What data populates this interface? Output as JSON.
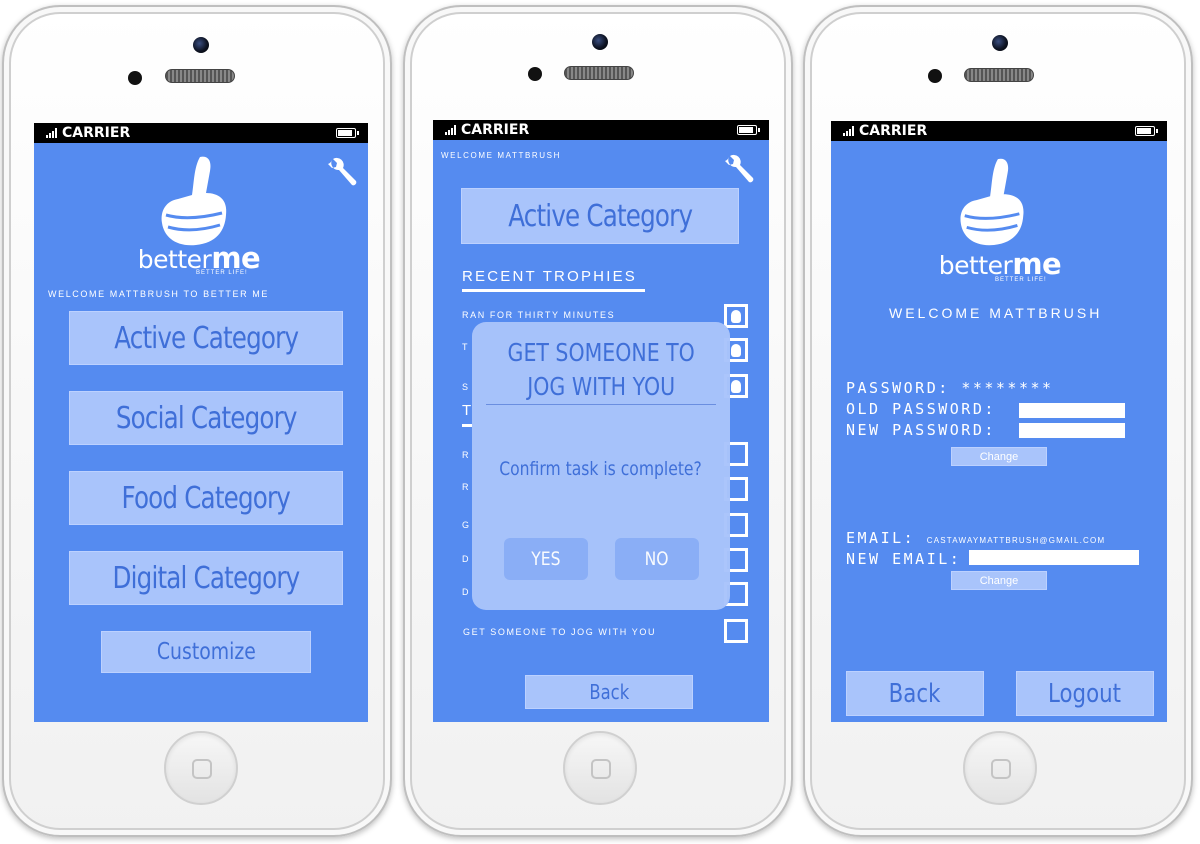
{
  "carrier": "CARRIER",
  "brand": {
    "logo_prefix": "better",
    "logo_suffix": "me",
    "tagline": "BETTER LIFE!"
  },
  "screen1": {
    "welcome": "WELCOME MATTBRUSH TO BETTER ME",
    "categories": [
      "Active Category",
      "Social Category",
      "Food Category",
      "Digital Category"
    ],
    "customize_label": "Customize"
  },
  "screen2": {
    "welcome": "WELCOME MATTBRUSH",
    "category_button": "Active Category",
    "section_heading": "RECENT TROPHIES",
    "trophies": [
      "RAN FOR THIRTY MINUTES",
      "T",
      "S"
    ],
    "tasks_heading_initial": "T",
    "tasks": [
      "R",
      "R",
      "G",
      "D",
      "D",
      "GET SOMEONE TO JOG WITH YOU"
    ],
    "back_label": "Back",
    "modal": {
      "title_line1": "GET SOMEONE TO",
      "title_line2": "JOG WITH YOU",
      "question": "Confirm task is complete?",
      "yes_label": "YES",
      "no_label": "NO"
    }
  },
  "screen3": {
    "welcome": "WELCOME MATTBRUSH",
    "password_label": "PASSWORD:",
    "password_value": "********",
    "old_password_label": "OLD PASSWORD:",
    "new_password_label": "NEW PASSWORD:",
    "change_label": "Change",
    "email_label": "EMAIL:",
    "email_value": "CASTAWAYMATTBRUSH@GMAIL.COM",
    "new_email_label": "NEW EMAIL:",
    "change_label_2": "Change",
    "back_label": "Back",
    "logout_label": "Logout"
  },
  "colors": {
    "screen_bg": "#558bf0",
    "button_bg": "#a9c4fb",
    "button_text": "#3f6fd8"
  }
}
